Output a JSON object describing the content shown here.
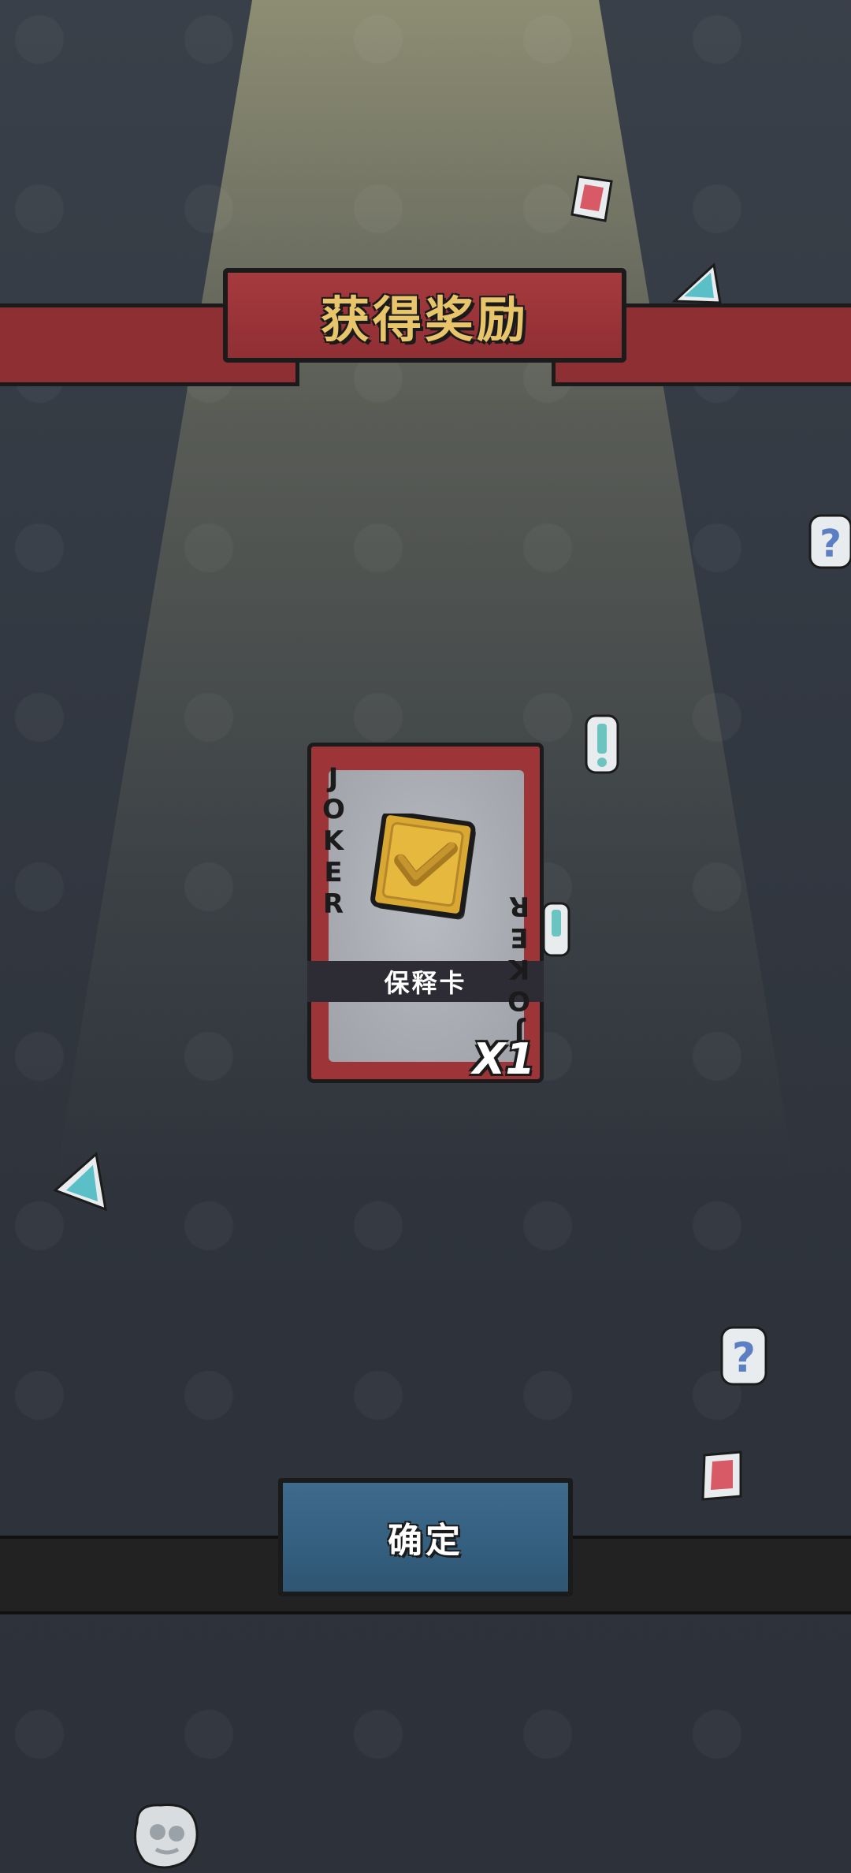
{
  "dialog": {
    "title": "获得奖励",
    "confirm_label": "确定"
  },
  "reward_card": {
    "corner_text_top": "JOKER",
    "corner_text_bottom": "JOKER",
    "name": "保释卡",
    "quantity": "X1",
    "icon": "shield-check-icon"
  },
  "colors": {
    "ribbon": "#8e2f33",
    "title_gold": "#e8c46a",
    "card_border": "#9c3438",
    "button_blue": "#356080",
    "spotlight": "#d2cd96"
  },
  "decorations": [
    "red-card-icon",
    "cyan-triangle-icon",
    "question-mark-icon",
    "exclamation-icon",
    "skull-bubble-icon"
  ]
}
